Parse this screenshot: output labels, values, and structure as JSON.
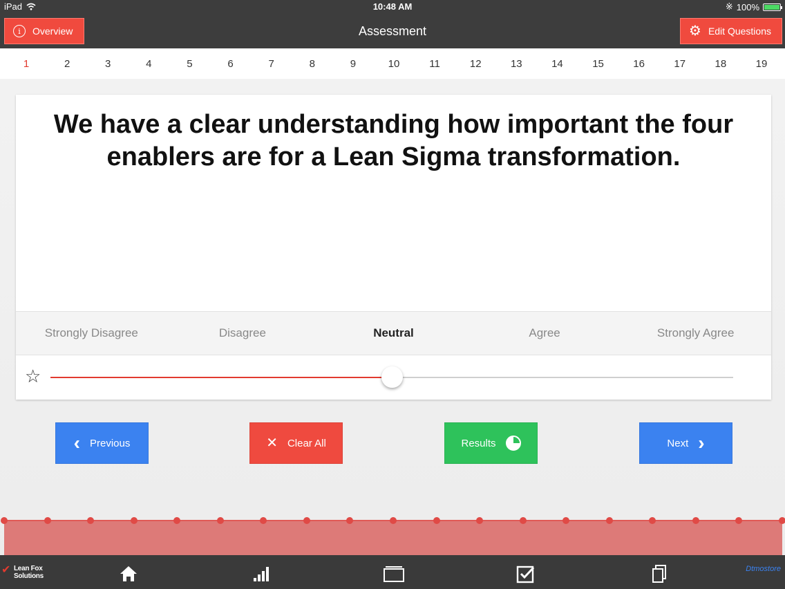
{
  "status_bar": {
    "device": "iPad",
    "time": "10:48 AM",
    "battery": "100%"
  },
  "nav": {
    "title": "Assessment",
    "overview_label": "Overview",
    "edit_label": "Edit Questions"
  },
  "questions": [
    "1",
    "2",
    "3",
    "4",
    "5",
    "6",
    "7",
    "8",
    "9",
    "10",
    "11",
    "12",
    "13",
    "14",
    "15",
    "16",
    "17",
    "18",
    "19"
  ],
  "current_question": 1,
  "question_text": "We have a clear understanding how important the four enablers are for a Lean Sigma transformation.",
  "scale": {
    "options": [
      "Strongly Disagree",
      "Disagree",
      "Neutral",
      "Agree",
      "Strongly Agree"
    ],
    "selected": "Neutral",
    "slider_fraction": 0.5
  },
  "actions": {
    "previous_label": "Previous",
    "clear_label": "Clear All",
    "results_label": "Results",
    "next_label": "Next"
  },
  "progress_points": 19,
  "tab_bar": {
    "logo_line1": "Lean Fox",
    "logo_line2": "Solutions",
    "brand_right": "Dtmostore"
  },
  "colors": {
    "accent_red": "#f04a3e",
    "blue": "#3b82f0",
    "green": "#2ec25b",
    "bar_dark": "#3d3d3d"
  }
}
